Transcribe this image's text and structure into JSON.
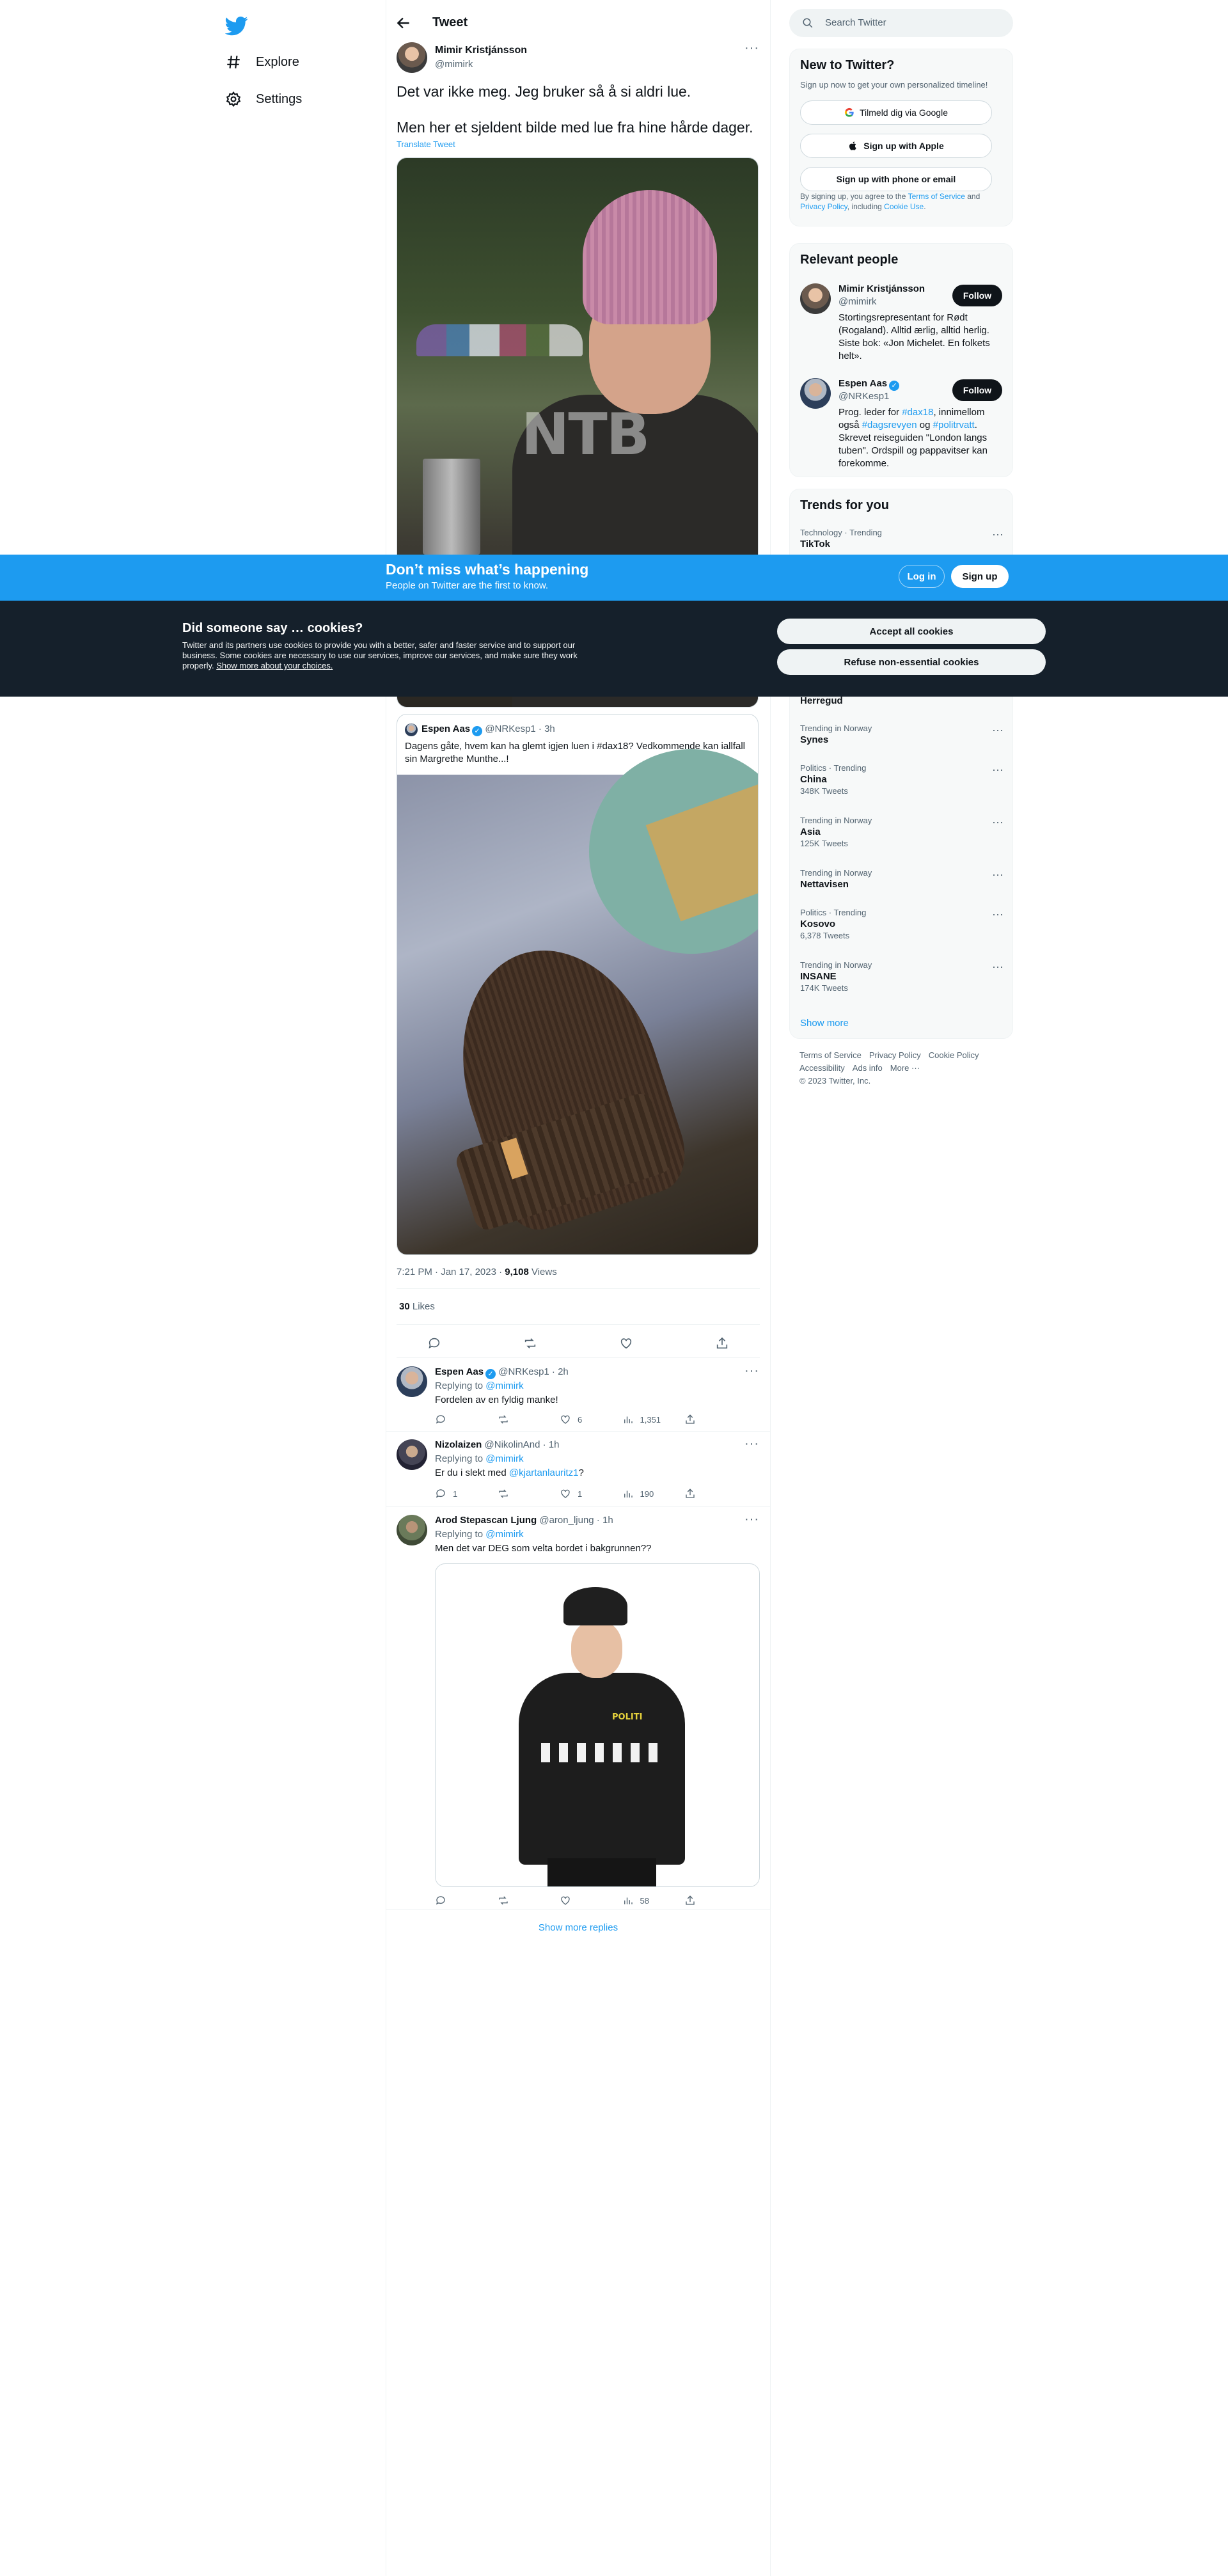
{
  "nav": {
    "items": [
      {
        "label": "Explore",
        "icon": "hashtag-icon"
      },
      {
        "label": "Settings",
        "icon": "gear-icon"
      }
    ]
  },
  "header": {
    "title": "Tweet"
  },
  "tweet": {
    "author": "Mimir Kristjánsson",
    "handle": "@mimirk",
    "line1": "Det var ikke meg. Jeg bruker så å si aldri lue.",
    "line2": "Men her et sjeldent bilde med lue fra hine hårde dager.",
    "translate": "Translate Tweet",
    "photo_watermark": "NTB",
    "time": "7:21 PM · Jan 17, 2023 · ",
    "views_count": "9,108",
    "views_label": " Views",
    "likes_count": "30",
    "likes_label": " Likes"
  },
  "quote": {
    "author": "Espen Aas",
    "handle_time": "@NRKesp1 · 3h",
    "text": "Dagens gåte, hvem kan ha glemt igjen luen i #dax18? Vedkommende kan iallfall sin Margrethe Munthe...!"
  },
  "replies": [
    {
      "author": "Espen Aas",
      "handle_time": "@NRKesp1 · 2h",
      "replying": "Replying to ",
      "replying_to": "@mimirk",
      "text": "Fordelen av en fyldig manke!",
      "replies": "",
      "retweets": "",
      "likes": "6",
      "views": "1,351"
    },
    {
      "author": "Nizolaizen",
      "handle_time": "@NikolinAnd · 1h",
      "replying": "Replying to ",
      "replying_to": "@mimirk",
      "text_pre": "Er du i slekt med ",
      "text_link": "@kjartanlauritz1",
      "text_post": "?",
      "replies": "1",
      "retweets": "",
      "likes": "1",
      "views": "190"
    },
    {
      "author": "Arod Stepascan Ljung",
      "handle_time": "@aron_ljung · 1h",
      "replying": "Replying to ",
      "replying_to": "@mimirk",
      "text": "Men det var DEG som velta bordet i bakgrunnen??",
      "photo_text": "POLITI",
      "replies": "",
      "retweets": "",
      "likes": "",
      "views": "58"
    }
  ],
  "show_more_replies": "Show more replies",
  "search": {
    "placeholder": "Search Twitter"
  },
  "new_to_twitter": {
    "title": "New to Twitter?",
    "subtitle": "Sign up now to get your own personalized timeline!",
    "google": "Tilmeld dig via Google",
    "apple": "Sign up with Apple",
    "phone": "Sign up with phone or email",
    "legal_pre": "By signing up, you agree to the ",
    "legal_terms": "Terms of Service",
    "legal_and": " and ",
    "legal_privacy": "Privacy Policy",
    "legal_incl": ", including ",
    "legal_cookie": "Cookie Use",
    "legal_end": "."
  },
  "relevant": {
    "title": "Relevant people",
    "people": [
      {
        "name": "Mimir Kristjánsson",
        "handle": "@mimirk",
        "bio": "Stortingsrepresentant for Rødt (Rogaland). Alltid ærlig, alltid herlig. Siste bok: «Jon Michelet. En folkets helt».",
        "follow": "Follow"
      },
      {
        "name": "Espen Aas",
        "handle": "@NRKesp1",
        "bio_pre": "Prog. leder for ",
        "bio_l1": "#dax18",
        "bio_mid1": ", innimellom også ",
        "bio_l2": "#dagsrevyen",
        "bio_mid2": " og ",
        "bio_l3": "#politrvatt",
        "bio_post": ". Skrevet reiseguiden \"London langs tuben\". Ordspill og pappavitser kan forekomme.",
        "follow": "Follow"
      }
    ]
  },
  "trends": {
    "title": "Trends for you",
    "items": [
      {
        "context": "Technology · Trending",
        "name": "TikTok",
        "count": ""
      },
      {
        "context": "",
        "name": "Herregud",
        "count": ""
      },
      {
        "context": "Trending in Norway",
        "name": "Synes",
        "count": ""
      },
      {
        "context": "Politics · Trending",
        "name": "China",
        "count": "348K Tweets"
      },
      {
        "context": "Trending in Norway",
        "name": "Asia",
        "count": "125K Tweets"
      },
      {
        "context": "Trending in Norway",
        "name": "Nettavisen",
        "count": ""
      },
      {
        "context": "Politics · Trending",
        "name": "Kosovo",
        "count": "6,378 Tweets"
      },
      {
        "context": "Trending in Norway",
        "name": "INSANE",
        "count": "174K Tweets"
      }
    ],
    "show_more": "Show more"
  },
  "footer": {
    "links1": [
      "Terms of Service",
      "Privacy Policy",
      "Cookie Policy"
    ],
    "links2": [
      "Accessibility",
      "Ads info",
      "More ···"
    ],
    "copyright": "© 2023 Twitter, Inc."
  },
  "banner": {
    "title": "Don’t miss what’s happening",
    "subtitle": "People on Twitter are the first to know.",
    "login": "Log in",
    "signup": "Sign up"
  },
  "cookie": {
    "title": "Did someone say … cookies?",
    "text": "Twitter and its partners use cookies to provide you with a better, safer and faster service and to support our business. Some cookies are necessary to use our services, improve our services, and make sure they work properly. ",
    "link": "Show more about your choices.",
    "accept": "Accept all cookies",
    "refuse": "Refuse non-essential cookies"
  },
  "colors": {
    "accent": "#1d9bf0",
    "cookie_bg": "#15202b",
    "text": "#0f1419",
    "muted": "#536471"
  }
}
